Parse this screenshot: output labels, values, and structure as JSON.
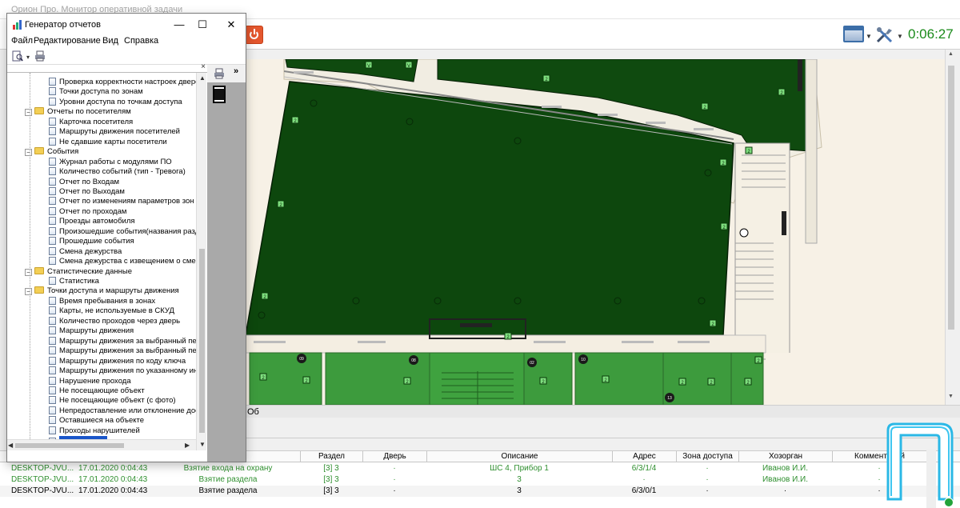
{
  "app": {
    "title": "Орион Про. Монитор оперативной задачи",
    "clock": "0:06:27",
    "map_status": "Об"
  },
  "report_window": {
    "title": "Генератор отчетов",
    "controls": {
      "minimize": "—",
      "maximize": "☐",
      "close": "✕"
    },
    "menu": [
      "Файл",
      "Редактирование",
      "Вид",
      "Справка"
    ],
    "pane_close": "×",
    "expand_glyph": "»",
    "tree": [
      {
        "type": "item",
        "label": "Проверка корректности настроек дверей",
        "level": 2
      },
      {
        "type": "item",
        "label": "Точки доступа по зонам",
        "level": 2
      },
      {
        "type": "item",
        "label": "Уровни доступа по точкам доступа",
        "level": 2
      },
      {
        "type": "folder",
        "label": "Отчеты по посетителям",
        "level": 1
      },
      {
        "type": "item",
        "label": "Карточка посетителя",
        "level": 2
      },
      {
        "type": "item",
        "label": "Маршруты движения посетителей",
        "level": 2
      },
      {
        "type": "item",
        "label": "Не сдавшие карты посетители",
        "level": 2
      },
      {
        "type": "folder",
        "label": "События",
        "level": 1
      },
      {
        "type": "item",
        "label": "Журнал работы с модулями ПО",
        "level": 2
      },
      {
        "type": "item",
        "label": "Количество событий (тип - Тревога)",
        "level": 2
      },
      {
        "type": "item",
        "label": "Отчет по Входам",
        "level": 2
      },
      {
        "type": "item",
        "label": "Отчет по Выходам",
        "level": 2
      },
      {
        "type": "item",
        "label": "Отчет по изменениям параметров зон пер",
        "level": 2
      },
      {
        "type": "item",
        "label": "Отчет по проходам",
        "level": 2
      },
      {
        "type": "item",
        "label": "Проезды автомобиля",
        "level": 2
      },
      {
        "type": "item",
        "label": "Произошедшие события(названия раздел",
        "level": 2
      },
      {
        "type": "item",
        "label": "Прошедшие события",
        "level": 2
      },
      {
        "type": "item",
        "label": "Смена дежурства",
        "level": 2
      },
      {
        "type": "item",
        "label": "Смена дежурства с извещением о смене",
        "level": 2
      },
      {
        "type": "folder",
        "label": "Статистические данные",
        "level": 1
      },
      {
        "type": "item",
        "label": "Статистика",
        "level": 2
      },
      {
        "type": "folder",
        "label": "Точки доступа и маршруты движения",
        "level": 1
      },
      {
        "type": "item",
        "label": "Время пребывания в зонах",
        "level": 2
      },
      {
        "type": "item",
        "label": "Карты, не используемые в СКУД",
        "level": 2
      },
      {
        "type": "item",
        "label": "Количество проходов через дверь",
        "level": 2
      },
      {
        "type": "item",
        "label": "Маршруты движения",
        "level": 2
      },
      {
        "type": "item",
        "label": "Маршруты движения за выбранный перис",
        "level": 2
      },
      {
        "type": "item",
        "label": "Маршруты движения за выбранный перис",
        "level": 2
      },
      {
        "type": "item",
        "label": "Маршруты движения по коду ключа",
        "level": 2
      },
      {
        "type": "item",
        "label": "Маршруты движения по указанному интер",
        "level": 2
      },
      {
        "type": "item",
        "label": "Нарушение прохода",
        "level": 2
      },
      {
        "type": "item",
        "label": "Не посещающие объект",
        "level": 2
      },
      {
        "type": "item",
        "label": "Не посещающие объект (с фото)",
        "level": 2
      },
      {
        "type": "item",
        "label": "Непредоставление или отклонение доступ",
        "level": 2
      },
      {
        "type": "item",
        "label": "Оставшиеся на объекте",
        "level": 2
      },
      {
        "type": "item",
        "label": "Проходы нарушителей",
        "level": 2
      },
      {
        "type": "item",
        "label": "",
        "level": 2,
        "selected": true
      }
    ]
  },
  "events": {
    "columns": [
      "Раздел",
      "Дверь",
      "Описание",
      "Адрес",
      "Зона доступа",
      "Хозорган",
      "Комментарий"
    ],
    "rows": [
      {
        "style": "green",
        "computer": "DESKTOP-JVU...",
        "time": "17.01.2020 0:04:43",
        "event": "Взятие входа на охрану",
        "section": "[3] 3",
        "door": "·",
        "description": "ШС 4, Прибор 1",
        "address": "6/3/1/4",
        "zone": "·",
        "owner": "Иванов И.И.",
        "comment": "·"
      },
      {
        "style": "green",
        "computer": "DESKTOP-JVU...",
        "time": "17.01.2020 0:04:43",
        "event": "Взятие раздела",
        "section": "[3] 3",
        "door": "·",
        "description": "3",
        "address": "·",
        "zone": "·",
        "owner": "Иванов И.И.",
        "comment": "·"
      },
      {
        "style": "black",
        "computer": "DESKTOP-JVU...",
        "time": "17.01.2020 0:04:43",
        "event": "Взятие раздела",
        "section": "[3] 3",
        "door": "·",
        "description": "3",
        "address": "6/3/0/1",
        "zone": "·",
        "owner": "·",
        "comment": "·"
      }
    ]
  },
  "map": {
    "marker_labels": [
      "V",
      "V",
      "2",
      "2",
      "2",
      "2",
      "2",
      "2",
      "2",
      "2",
      "2",
      "2",
      "2",
      "2",
      "2",
      "2",
      "2",
      "2",
      "2",
      "2",
      "2",
      "2"
    ],
    "zone_numbers": [
      "09",
      "08",
      "02",
      "10",
      "13"
    ]
  },
  "colors": {
    "map_dark_zone": "#0f4a0f",
    "map_light_zone": "#3d9b3d",
    "map_floor": "#f7f1e6",
    "clock": "#1a8a1a",
    "green_text": "#2f8f2f",
    "tree_selection": "#1a56c9"
  }
}
